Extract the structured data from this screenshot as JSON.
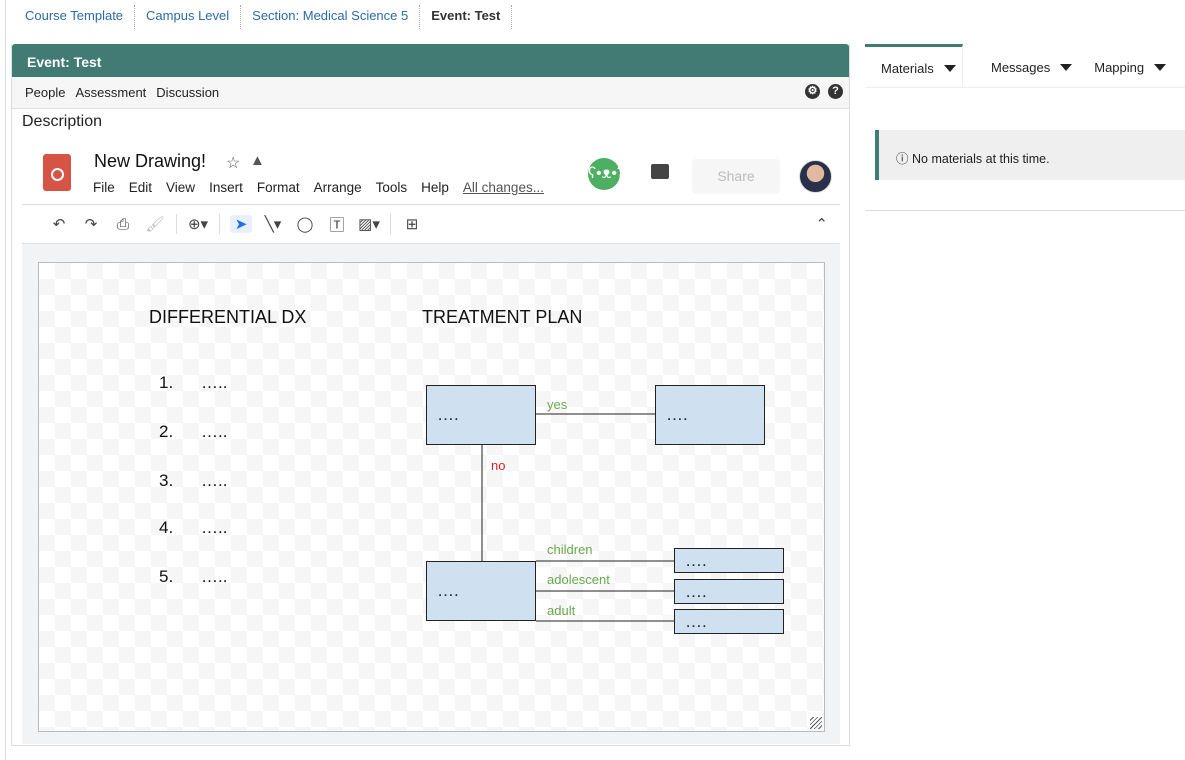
{
  "breadcrumbs": [
    "Course Template",
    "Campus Level",
    "Section: Medical Science 5",
    "Event: Test"
  ],
  "panel": {
    "title": "Event: Test",
    "nav": [
      "People",
      "Assessment",
      "Discussion"
    ],
    "description": "Description"
  },
  "doc": {
    "title": "New Drawing!",
    "menu": [
      "File",
      "Edit",
      "View",
      "Insert",
      "Format",
      "Arrange",
      "Tools",
      "Help"
    ],
    "status": "All changes...",
    "share": "Share"
  },
  "drawing": {
    "heading_left": "DIFFERENTIAL DX",
    "heading_right": "TREATMENT PLAN",
    "list": [
      {
        "n": "1.",
        "v": "….."
      },
      {
        "n": "2.",
        "v": "….."
      },
      {
        "n": "3.",
        "v": "….."
      },
      {
        "n": "4.",
        "v": "….."
      },
      {
        "n": "5.",
        "v": "….."
      }
    ],
    "box_text": "….",
    "yes": "yes",
    "no": "no",
    "children": "children",
    "adolescent": "adolescent",
    "adult": "adult"
  },
  "sidebar": {
    "tabs": [
      "Materials",
      "Messages",
      "Mapping"
    ],
    "message": "No materials at this time."
  }
}
